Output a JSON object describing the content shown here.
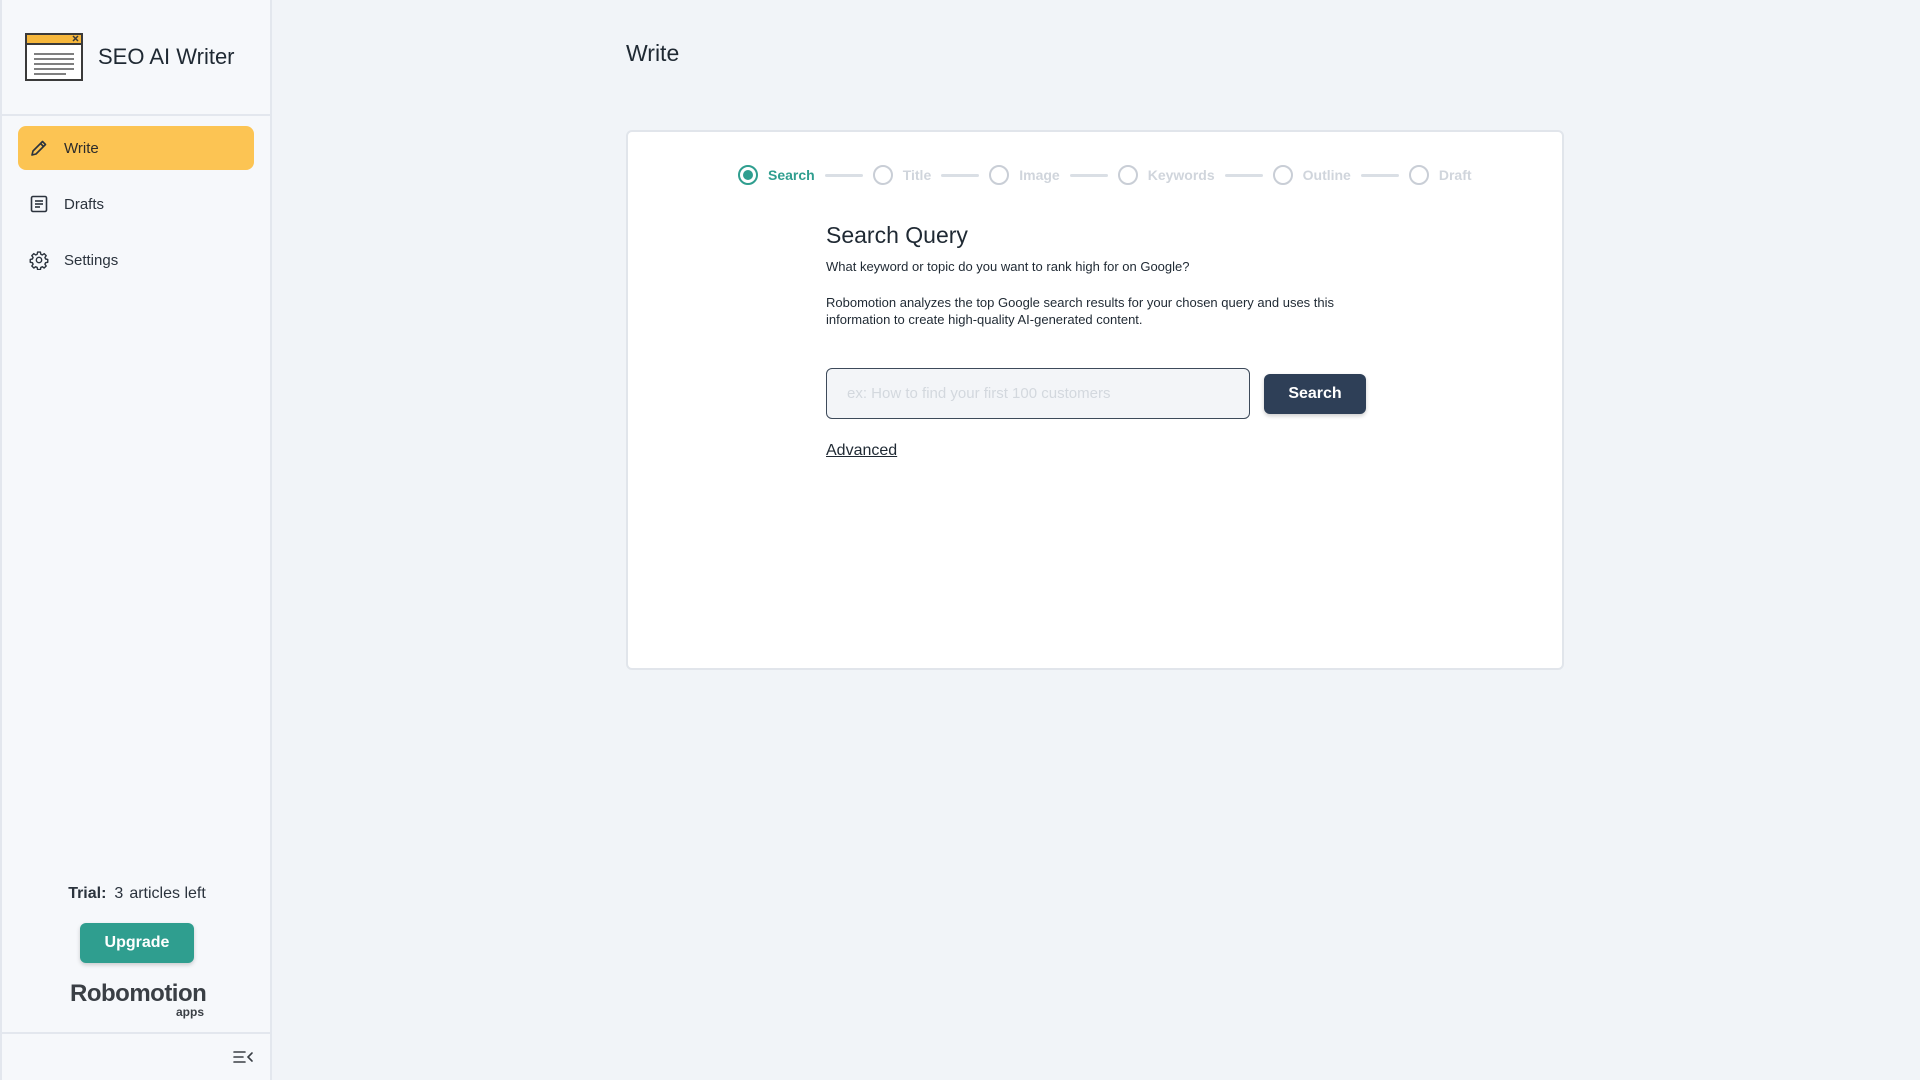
{
  "app": {
    "name": "SEO AI Writer",
    "logo_icon": "document-window-icon"
  },
  "sidebar": {
    "items": [
      {
        "label": "Write",
        "icon": "pencil-icon",
        "active": true
      },
      {
        "label": "Drafts",
        "icon": "document-list-icon",
        "active": false
      },
      {
        "label": "Settings",
        "icon": "gear-icon",
        "active": false
      }
    ],
    "trial": {
      "label": "Trial:",
      "count": "3",
      "suffix": "articles left"
    },
    "upgrade_label": "Upgrade",
    "brand_logo": {
      "word": "Robomotion",
      "sub": "apps"
    },
    "collapse_icon": "collapse-menu-icon"
  },
  "page": {
    "title": "Write"
  },
  "stepper": {
    "steps": [
      {
        "label": "Search",
        "active": true
      },
      {
        "label": "Title",
        "active": false
      },
      {
        "label": "Image",
        "active": false
      },
      {
        "label": "Keywords",
        "active": false
      },
      {
        "label": "Outline",
        "active": false
      },
      {
        "label": "Draft",
        "active": false
      }
    ]
  },
  "form": {
    "title": "Search Query",
    "question": "What keyword or topic do you want to rank high for on Google?",
    "description": "Robomotion analyzes the top Google search results for your chosen query and uses this information to create high-quality AI-generated content.",
    "input_value": "",
    "input_placeholder": "ex: How to find your first 100 customers",
    "search_label": "Search",
    "advanced_label": "Advanced"
  },
  "colors": {
    "accent_yellow": "#fcc453",
    "accent_teal": "#2f9e8f",
    "button_dark": "#2e3f57",
    "background": "#f1f4f8"
  }
}
